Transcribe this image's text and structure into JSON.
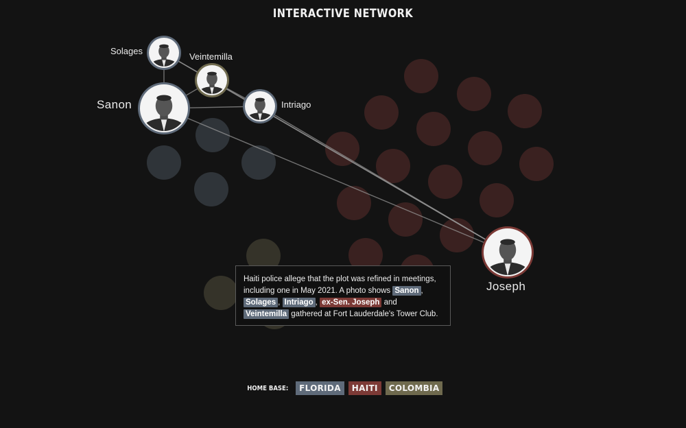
{
  "header": {
    "title": "INTERACTIVE NETWORK"
  },
  "colors": {
    "florida": "#5f6b7a",
    "haiti": "#7c3a36",
    "colombia": "#6f6a4e",
    "background": "#131313"
  },
  "people": [
    {
      "name": "Solages",
      "group": "florida",
      "icon": "portrait-icon"
    },
    {
      "name": "Veintemilla",
      "group": "colombia",
      "icon": "portrait-icon"
    },
    {
      "name": "Sanon",
      "group": "florida",
      "icon": "portrait-icon"
    },
    {
      "name": "Intriago",
      "group": "florida",
      "icon": "portrait-icon"
    },
    {
      "name": "Joseph",
      "group": "haiti",
      "icon": "portrait-icon"
    }
  ],
  "links": [
    [
      "Sanon",
      "Solages"
    ],
    [
      "Sanon",
      "Veintemilla"
    ],
    [
      "Sanon",
      "Intriago"
    ],
    [
      "Sanon",
      "Joseph"
    ],
    [
      "Solages",
      "Veintemilla"
    ],
    [
      "Veintemilla",
      "Intriago"
    ],
    [
      "Intriago",
      "Joseph"
    ],
    [
      "Solages",
      "Joseph"
    ],
    [
      "Veintemilla",
      "Joseph"
    ]
  ],
  "caption": {
    "text_1": "Haiti police allege that the plot was refined in meetings, including one in May 2021. A photo shows ",
    "tag_sanon": "Sanon",
    "sep_1": ", ",
    "tag_solages": "Solages",
    "sep_2": ", ",
    "tag_intriago": "Intriago",
    "sep_3": ", ",
    "tag_joseph": "ex-Sen. Joseph",
    "sep_4": " and ",
    "tag_veintemilla": "Veintemilla",
    "text_2": " gathered at Fort Lauderdale's Tower Club."
  },
  "legend": {
    "label": "HOME BASE:",
    "items": [
      {
        "label": "FLORIDA",
        "color": "#5f6b7a"
      },
      {
        "label": "HAITI",
        "color": "#7c3a36"
      },
      {
        "label": "COLOMBIA",
        "color": "#6f6a4e"
      }
    ]
  }
}
